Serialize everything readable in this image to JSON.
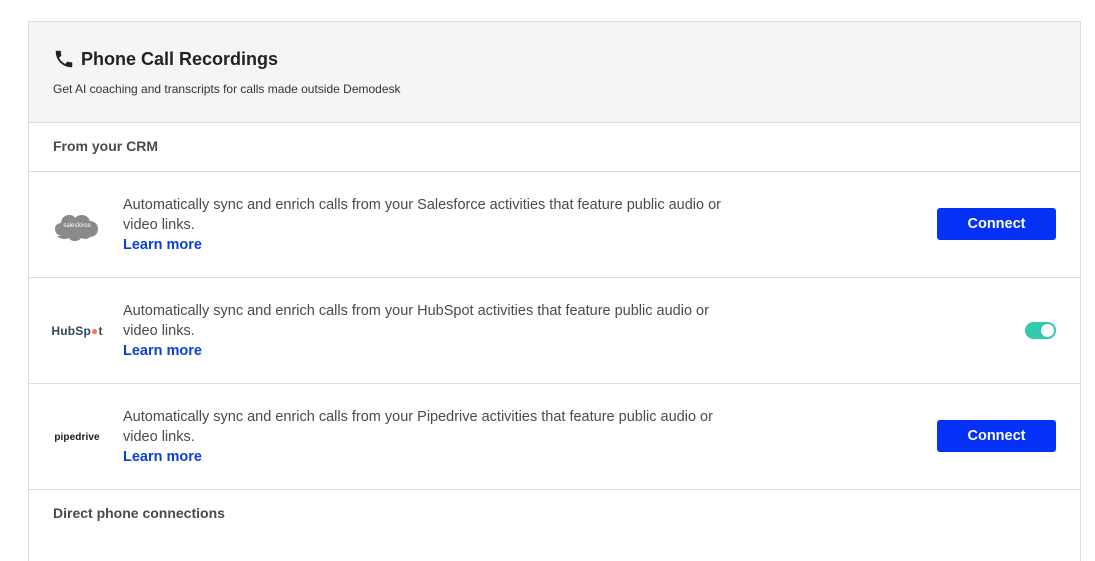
{
  "header": {
    "title": "Phone Call Recordings",
    "subtitle": "Get AI coaching and transcripts for calls made outside Demodesk",
    "icon": "phone-icon"
  },
  "sections": {
    "crm_label": "From your CRM",
    "direct_label": "Direct phone connections"
  },
  "integrations": [
    {
      "name": "Salesforce",
      "logo_text": "salesforce",
      "description": "Automatically sync and enrich calls from your Salesforce activities that feature public audio or video links.",
      "link": "Learn more",
      "action": "Connect"
    },
    {
      "name": "HubSpot",
      "logo_text_a": "HubSp",
      "logo_text_b": "t",
      "description": "Automatically sync and enrich calls from your HubSpot activities that feature public audio or video links.",
      "link": "Learn more",
      "toggle_on": true
    },
    {
      "name": "Pipedrive",
      "logo_text": "pipedrive",
      "description": "Automatically sync and enrich calls from your Pipedrive activities that feature public audio or video links.",
      "link": "Learn more",
      "action": "Connect"
    }
  ],
  "colors": {
    "accent": "#0530f5",
    "link": "#0b3fd9",
    "toggle": "#33c9ab",
    "header_bg": "#f4f5f7"
  }
}
